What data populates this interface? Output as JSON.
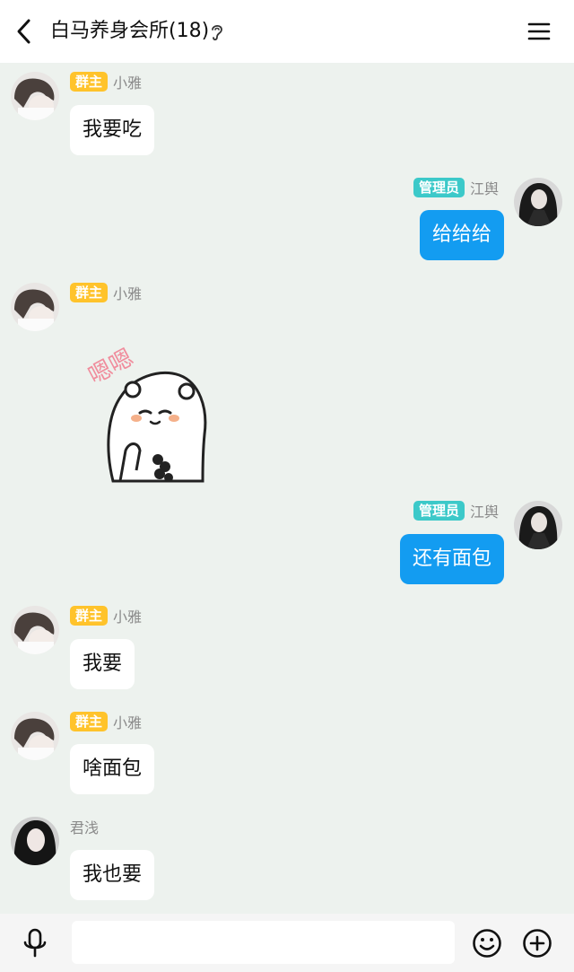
{
  "header": {
    "title": "白马养身会所(18)",
    "back_icon": "chevron-left-icon",
    "ear_icon": "ear-icon",
    "menu_icon": "hamburger-menu-icon"
  },
  "messages": [
    {
      "sender": "小雅",
      "role": "群主",
      "side": "in",
      "text": "我要吃"
    },
    {
      "sender": "江舆",
      "role": "管理员",
      "side": "out",
      "text": "给给给"
    },
    {
      "sender": "小雅",
      "role": "群主",
      "side": "in",
      "sticker_text": "嗯嗯"
    },
    {
      "sender": "江舆",
      "role": "管理员",
      "side": "out",
      "text": "还有面包"
    },
    {
      "sender": "小雅",
      "role": "群主",
      "side": "in",
      "text": "我要"
    },
    {
      "sender": "小雅",
      "role": "群主",
      "side": "in",
      "text": "啥面包"
    },
    {
      "sender": "君浅",
      "role": "",
      "side": "in",
      "text": "我也要"
    }
  ],
  "composer": {
    "placeholder": "",
    "mic_icon": "microphone-icon",
    "emoji_icon": "smiley-icon",
    "plus_icon": "plus-circle-icon"
  },
  "colors": {
    "background": "#edf2ee",
    "outgoing_bubble": "#139cf1",
    "owner_badge": "#ffc32b",
    "admin_badge": "#3cc9c9"
  }
}
